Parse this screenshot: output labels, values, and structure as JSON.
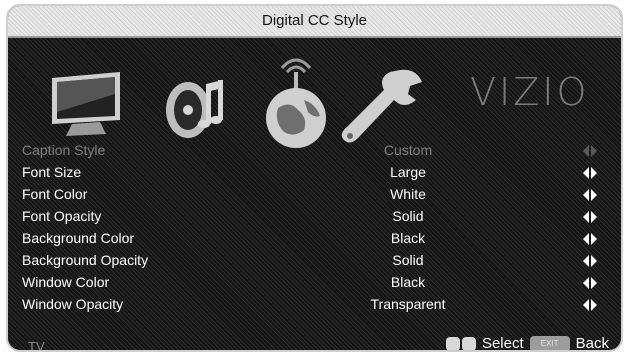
{
  "window": {
    "title": "Digital CC Style"
  },
  "brand": {
    "logo_text": "VIZIO"
  },
  "menu_icons": [
    "tv-icon",
    "music-note-icon",
    "globe-network-icon",
    "wrench-settings-icon"
  ],
  "settings": [
    {
      "label": "Caption Style",
      "value": "Custom",
      "dim": true
    },
    {
      "label": "Font Size",
      "value": "Large"
    },
    {
      "label": "Font Color",
      "value": "White"
    },
    {
      "label": "Font Opacity",
      "value": "Solid"
    },
    {
      "label": "Background Color",
      "value": "Black"
    },
    {
      "label": "Background Opacity",
      "value": "Solid"
    },
    {
      "label": "Window Color",
      "value": "Black"
    },
    {
      "label": "Window Opacity",
      "value": "Transparent"
    }
  ],
  "footer": {
    "source": "TV",
    "select_label": "Select",
    "back_label": "Back",
    "exit_button": "EXIT"
  },
  "colors": {
    "background": "#141414",
    "title_bar": "#e9e9e9",
    "text": "#ffffff",
    "dim_text": "#7f7f7f"
  }
}
